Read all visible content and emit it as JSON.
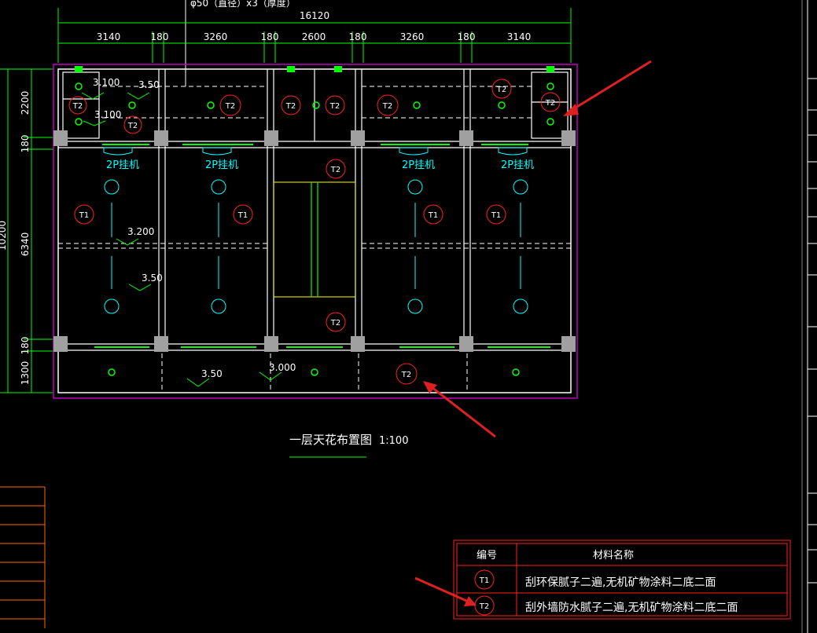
{
  "drawing": {
    "top_note": "φ50（直径）x3（厚度）",
    "overall_width": "16120",
    "top_dims": [
      "3140",
      "180",
      "3260",
      "180",
      "2600",
      "180",
      "3260",
      "180",
      "3140"
    ],
    "left_dims": [
      "2200",
      "180",
      "6340",
      "180",
      "1300"
    ],
    "left_total": "10200",
    "title": "一层天花布置图",
    "scale": "1:100",
    "room_labels": [
      "2P挂机",
      "2P挂机",
      "2P挂机",
      "2P挂机"
    ],
    "levels": [
      "3.100",
      "3.50",
      "3.100",
      "3.200",
      "3.50",
      "3.50",
      "3.000"
    ],
    "finish_tags": {
      "t1": "T1",
      "t2": "T2"
    }
  },
  "legend": {
    "header_code": "编号",
    "header_material": "材料名称",
    "rows": [
      {
        "code": "T1",
        "material": "刮环保腻子二遍,无机矿物涂料二底二面"
      },
      {
        "code": "T2",
        "material": "刮外墙防水腻子二遍,无机矿物涂料二底二面"
      }
    ]
  },
  "colors": {
    "wall": "#ffffff",
    "dim": "#00ff00",
    "cyan": "#00ffff",
    "red": "#ff2020",
    "magenta": "#c000c0",
    "yellow": "#ffff00",
    "grey": "#a0a0a0",
    "orange": "#ff6a00"
  }
}
